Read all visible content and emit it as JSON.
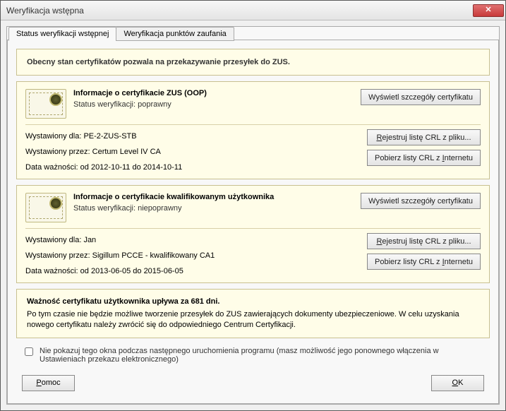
{
  "window": {
    "title": "Weryfikacja wstępna"
  },
  "tabs": {
    "status": "Status weryfikacji wstępnej",
    "trust": "Weryfikacja punktów zaufania"
  },
  "summary": "Obecny stan certyfikatów pozwala na przekazywanie przesyłek do ZUS.",
  "cert_zus": {
    "title": "Informacje o certyfikacie ZUS (OOP)",
    "status_label": "Status weryfikacji:",
    "status_value": "poprawny",
    "issued_for_label": "Wystawiony dla:",
    "issued_for": "PE-2-ZUS-STB",
    "issued_by_label": "Wystawiony przez:",
    "issued_by": "Certum Level IV CA",
    "validity_label": "Data ważności:",
    "validity": "od 2012-10-11 do 2014-10-11",
    "btn_details": "Wyświetl szczegóły certyfikatu",
    "btn_crl_file_pre": "R",
    "btn_crl_file_post": "ejestruj listę CRL z pliku...",
    "btn_crl_net_pre": "Pobierz listy CRL z ",
    "btn_crl_net_u": "I",
    "btn_crl_net_post": "nternetu"
  },
  "cert_user": {
    "title": "Informacje o certyfikacie kwalifikowanym użytkownika",
    "status_label": "Status weryfikacji:",
    "status_value": "niepoprawny",
    "issued_for_label": "Wystawiony dla:",
    "issued_for": "Jan",
    "issued_by_label": "Wystawiony przez:",
    "issued_by": "Sigillum PCCE - kwalifikowany CA1",
    "validity_label": "Data ważności:",
    "validity": "od 2013-06-05 do 2015-06-05",
    "btn_details": "Wyświetl szczegóły certyfikatu",
    "btn_crl_file_pre": "R",
    "btn_crl_file_post": "ejestruj listę CRL z pliku...",
    "btn_crl_net_pre": "Pobierz listy CRL z ",
    "btn_crl_net_u": "I",
    "btn_crl_net_post": "nternetu"
  },
  "validity": {
    "title": "Ważność certyfikatu użytkownika upływa za 681 dni.",
    "body": "Po tym czasie nie będzie możliwe tworzenie przesyłek do ZUS zawierających dokumenty ubezpieczeniowe. W celu uzyskania nowego certyfikatu należy zwrócić się do odpowiedniego Centrum Certyfikacji."
  },
  "checkbox": {
    "label": "Nie pokazuj tego okna podczas następnego uruchomienia programu (masz możliwość jego ponownego włączenia w Ustawieniach przekazu elektronicznego)"
  },
  "buttons": {
    "help_u": "P",
    "help_post": "omoc",
    "ok_u": "O",
    "ok_post": "K"
  }
}
